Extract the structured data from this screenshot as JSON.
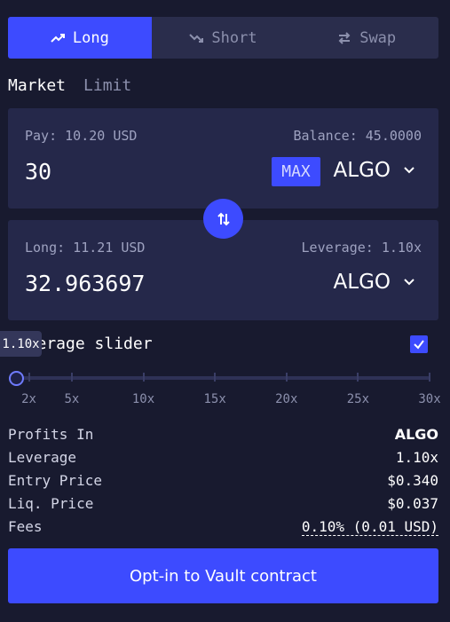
{
  "tabs": [
    {
      "label": "Long",
      "icon": "trend-up-icon",
      "active": true
    },
    {
      "label": "Short",
      "icon": "trend-down-icon",
      "active": false
    },
    {
      "label": "Swap",
      "icon": "swap-arrows-icon",
      "active": false
    }
  ],
  "order_types": [
    {
      "label": "Market",
      "active": true
    },
    {
      "label": "Limit",
      "active": false
    }
  ],
  "pay_panel": {
    "pay_label": "Pay: 10.20 USD",
    "balance_label": "Balance: 45.0000",
    "amount": "30",
    "max_label": "MAX",
    "token": "ALGO"
  },
  "long_panel": {
    "long_label": "Long: 11.21 USD",
    "leverage_label": "Leverage: 1.10x",
    "amount": "32.963697",
    "token": "ALGO"
  },
  "leverage": {
    "label": "Leverage slider",
    "tooltip": "1.10x",
    "enabled": true,
    "value": 1.1,
    "min": 1.1,
    "max": 30,
    "ticks": [
      "2x",
      "5x",
      "10x",
      "15x",
      "20x",
      "25x",
      "30x"
    ]
  },
  "info": {
    "profits_in": {
      "label": "Profits In",
      "value": "ALGO"
    },
    "leverage": {
      "label": "Leverage",
      "value": "1.10x"
    },
    "entry_price": {
      "label": "Entry Price",
      "value": "$0.340"
    },
    "liq_price": {
      "label": "Liq. Price",
      "value": "$0.037"
    },
    "fees": {
      "label": "Fees",
      "value": "0.10% (0.01 USD)"
    }
  },
  "cta_label": "Opt-in to Vault contract",
  "colors": {
    "accent": "#3d4bff",
    "background": "#181a2f",
    "panel": "#25284a"
  }
}
